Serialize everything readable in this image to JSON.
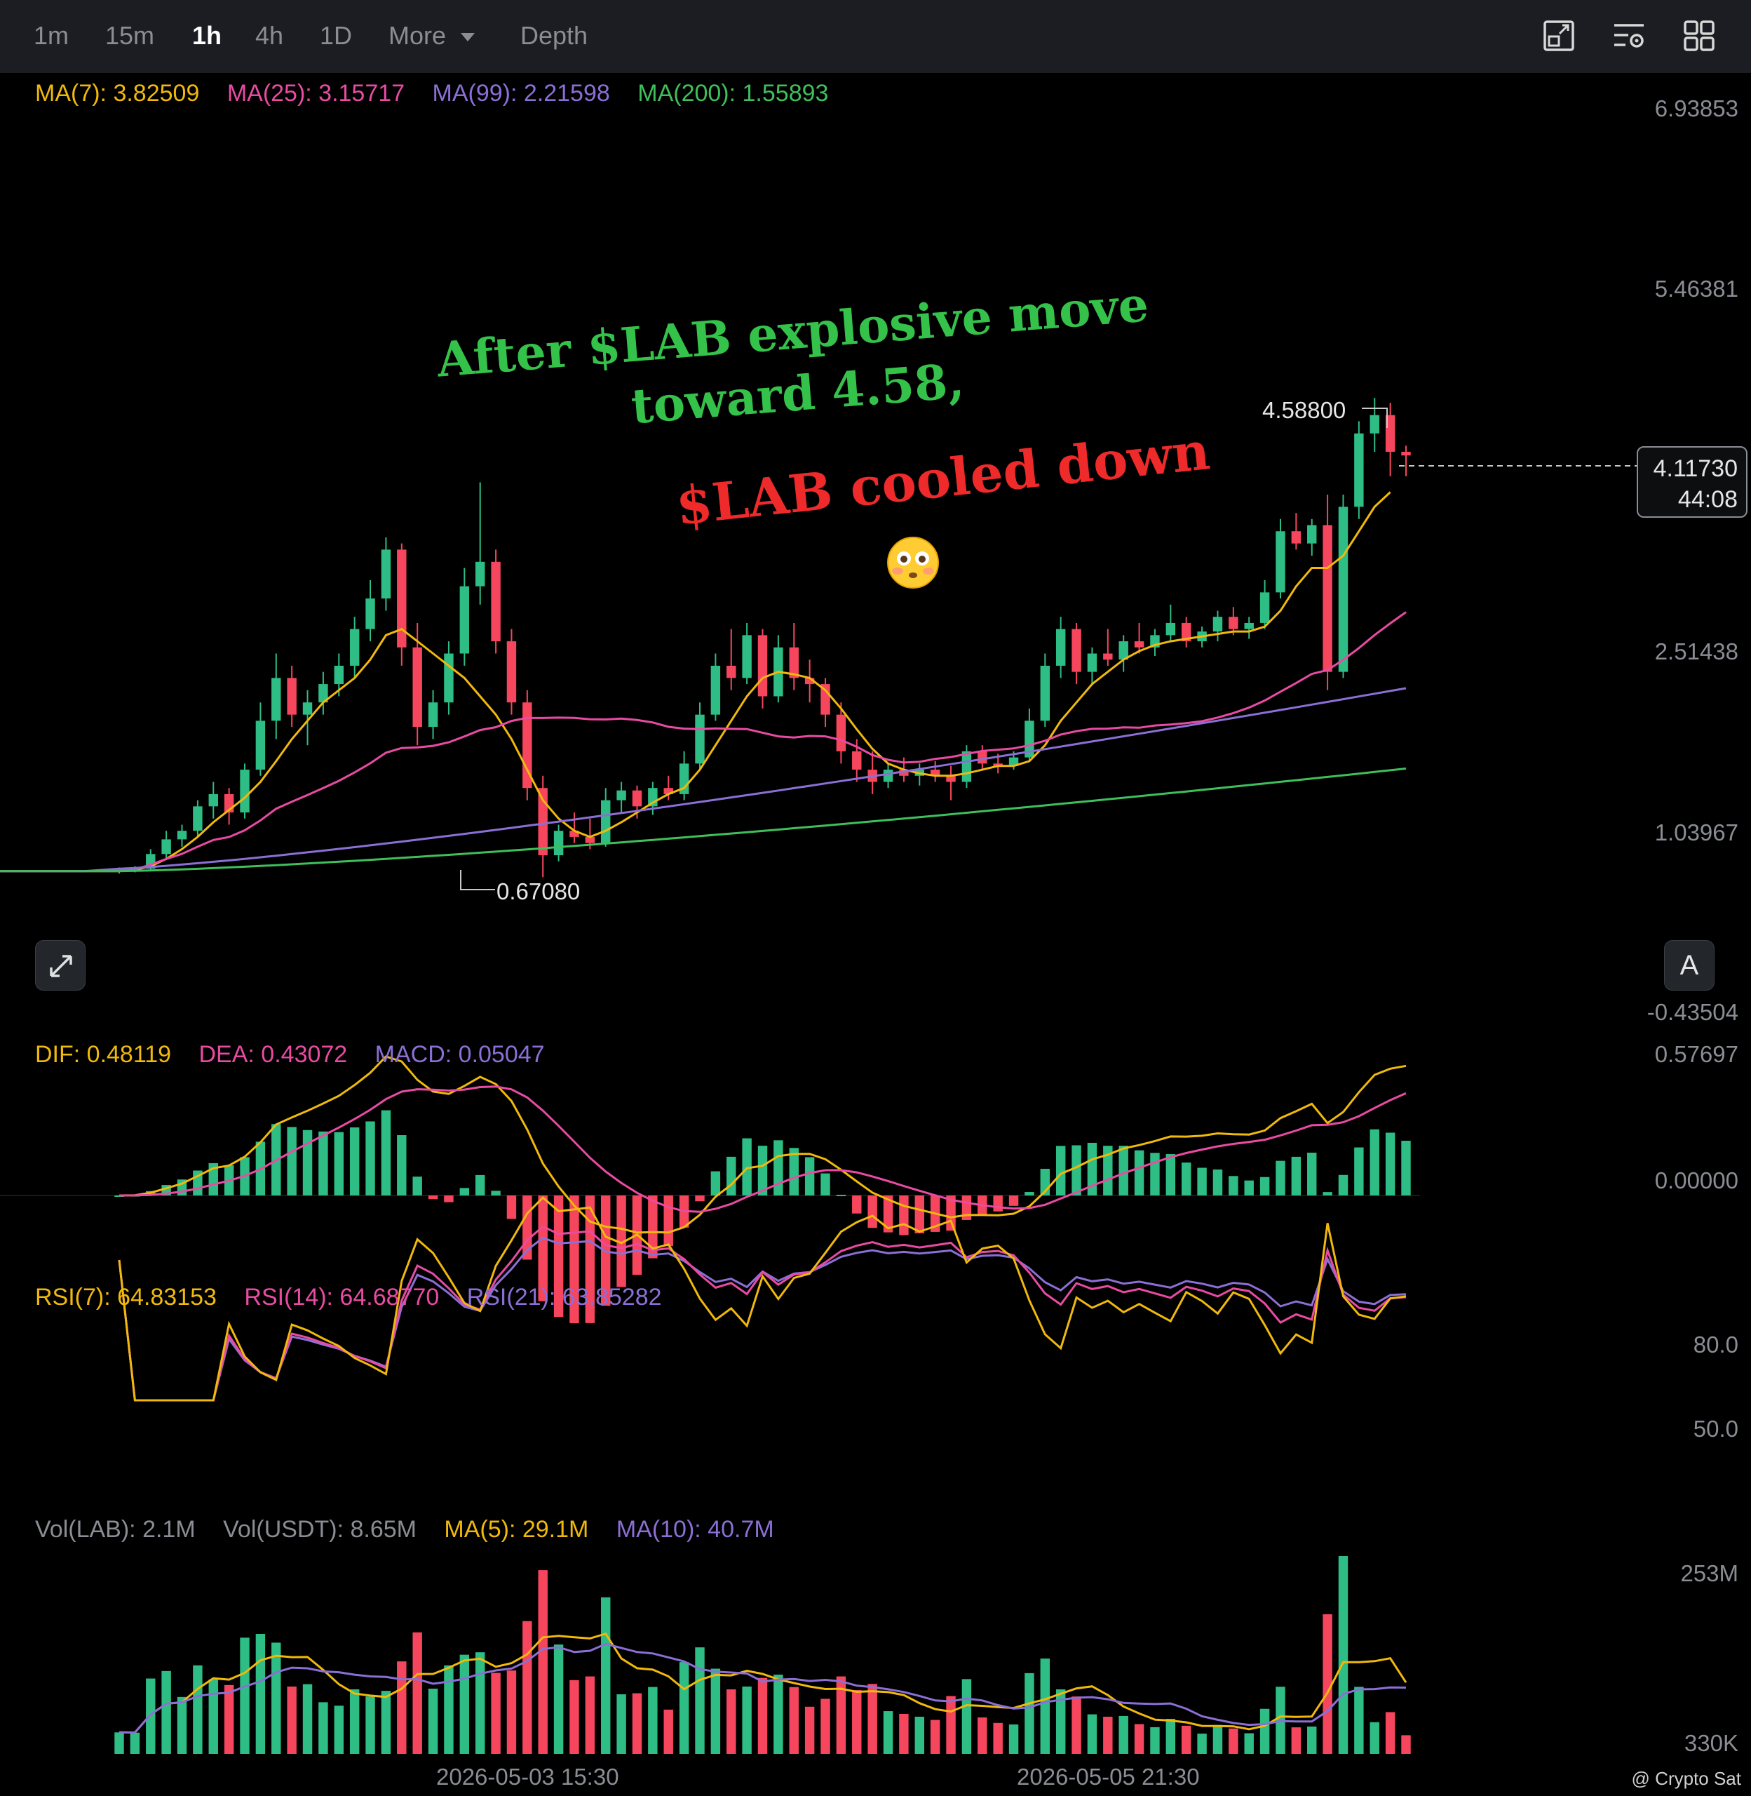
{
  "toolbar": {
    "timeframes": [
      "1m",
      "15m",
      "1h",
      "4h",
      "1D"
    ],
    "active_timeframe": "1h",
    "more_label": "More",
    "depth_label": "Depth",
    "icons": [
      "layout-toggle-icon",
      "indicator-settings-icon",
      "grid-view-icon"
    ]
  },
  "legends": {
    "ma": [
      {
        "text": "MA(7): 3.82509",
        "color": "#f0b90b"
      },
      {
        "text": "MA(25): 3.15717",
        "color": "#e94ba3"
      },
      {
        "text": "MA(99): 2.21598",
        "color": "#8b6fd6"
      },
      {
        "text": "MA(200): 1.55893",
        "color": "#3fbf5c"
      }
    ],
    "macd": [
      {
        "text": "DIF: 0.48119",
        "color": "#f0b90b"
      },
      {
        "text": "DEA: 0.43072",
        "color": "#e94ba3"
      },
      {
        "text": "MACD: 0.05047",
        "color": "#8b6fd6"
      }
    ],
    "rsi": [
      {
        "text": "RSI(7): 64.83153",
        "color": "#f0b90b"
      },
      {
        "text": "RSI(14): 64.68770",
        "color": "#e94ba3"
      },
      {
        "text": "RSI(21): 63.85282",
        "color": "#8b6fd6"
      }
    ],
    "vol": [
      {
        "text": "Vol(LAB): 2.1M",
        "color": "#8a8d93"
      },
      {
        "text": "Vol(USDT): 8.65M",
        "color": "#8a8d93"
      },
      {
        "text": "MA(5): 29.1M",
        "color": "#f0b90b"
      },
      {
        "text": "MA(10): 40.7M",
        "color": "#8b6fd6"
      }
    ]
  },
  "axes": {
    "price_ticks": [
      "6.93853",
      "5.46381",
      "2.51438",
      "1.03967",
      "-0.43504"
    ],
    "macd_ticks": [
      "0.57697",
      "0.00000"
    ],
    "rsi_ticks": [
      "80.0",
      "50.0"
    ],
    "vol_ticks": [
      "253M",
      "330K"
    ],
    "dates": [
      "2026-05-03 15:30",
      "2026-05-05 21:30"
    ]
  },
  "current_price": {
    "price": "4.11730",
    "countdown": "44:08"
  },
  "high_label": "4.58800",
  "low_label": "0.67080",
  "annotations": {
    "line1": "After $LAB explosive move",
    "line2": "toward 4.58,",
    "line3": "$LAB cooled down"
  },
  "auto_button": "A",
  "watermark": "@ Crypto Sat",
  "colors": {
    "up": "#2ebd85",
    "down": "#f6465d",
    "ma7": "#f0b90b",
    "ma25": "#e94ba3",
    "ma99": "#8b6fd6",
    "ma200": "#3fbf5c"
  },
  "chart_data": {
    "type": "candlestick",
    "interval": "1h",
    "ohlc_approx": [
      {
        "o": 0.72,
        "h": 0.75,
        "l": 0.7,
        "c": 0.73
      },
      {
        "o": 0.73,
        "h": 0.76,
        "l": 0.71,
        "c": 0.74
      },
      {
        "o": 0.74,
        "h": 0.9,
        "l": 0.72,
        "c": 0.86
      },
      {
        "o": 0.86,
        "h": 1.05,
        "l": 0.82,
        "c": 0.98
      },
      {
        "o": 0.98,
        "h": 1.1,
        "l": 0.92,
        "c": 1.05
      },
      {
        "o": 1.05,
        "h": 1.3,
        "l": 1.0,
        "c": 1.25
      },
      {
        "o": 1.25,
        "h": 1.45,
        "l": 1.15,
        "c": 1.35
      },
      {
        "o": 1.35,
        "h": 1.4,
        "l": 1.1,
        "c": 1.2
      },
      {
        "o": 1.2,
        "h": 1.6,
        "l": 1.15,
        "c": 1.55
      },
      {
        "o": 1.55,
        "h": 2.1,
        "l": 1.5,
        "c": 1.95
      },
      {
        "o": 1.95,
        "h": 2.5,
        "l": 1.8,
        "c": 2.3
      },
      {
        "o": 2.3,
        "h": 2.4,
        "l": 1.9,
        "c": 2.0
      },
      {
        "o": 2.0,
        "h": 2.2,
        "l": 1.75,
        "c": 2.1
      },
      {
        "o": 2.1,
        "h": 2.35,
        "l": 2.0,
        "c": 2.25
      },
      {
        "o": 2.25,
        "h": 2.5,
        "l": 2.15,
        "c": 2.4
      },
      {
        "o": 2.4,
        "h": 2.8,
        "l": 2.3,
        "c": 2.7
      },
      {
        "o": 2.7,
        "h": 3.1,
        "l": 2.6,
        "c": 2.95
      },
      {
        "o": 2.95,
        "h": 3.45,
        "l": 2.85,
        "c": 3.35
      },
      {
        "o": 3.35,
        "h": 3.4,
        "l": 2.4,
        "c": 2.55
      },
      {
        "o": 2.55,
        "h": 2.75,
        "l": 1.75,
        "c": 1.9
      },
      {
        "o": 1.9,
        "h": 2.2,
        "l": 1.8,
        "c": 2.1
      },
      {
        "o": 2.1,
        "h": 2.6,
        "l": 2.0,
        "c": 2.5
      },
      {
        "o": 2.5,
        "h": 3.2,
        "l": 2.4,
        "c": 3.05
      },
      {
        "o": 3.05,
        "h": 3.9,
        "l": 2.9,
        "c": 3.25
      },
      {
        "o": 3.25,
        "h": 3.35,
        "l": 2.5,
        "c": 2.6
      },
      {
        "o": 2.6,
        "h": 2.7,
        "l": 2.0,
        "c": 2.1
      },
      {
        "o": 2.1,
        "h": 2.2,
        "l": 1.3,
        "c": 1.4
      },
      {
        "o": 1.4,
        "h": 1.5,
        "l": 0.67,
        "c": 0.85
      },
      {
        "o": 0.85,
        "h": 1.1,
        "l": 0.8,
        "c": 1.05
      },
      {
        "o": 1.05,
        "h": 1.2,
        "l": 0.95,
        "c": 1.0
      },
      {
        "o": 1.0,
        "h": 1.15,
        "l": 0.9,
        "c": 0.95
      },
      {
        "o": 0.95,
        "h": 1.4,
        "l": 0.92,
        "c": 1.3
      },
      {
        "o": 1.3,
        "h": 1.45,
        "l": 1.2,
        "c": 1.38
      },
      {
        "o": 1.38,
        "h": 1.42,
        "l": 1.15,
        "c": 1.25
      },
      {
        "o": 1.25,
        "h": 1.45,
        "l": 1.18,
        "c": 1.4
      },
      {
        "o": 1.4,
        "h": 1.5,
        "l": 1.3,
        "c": 1.35
      },
      {
        "o": 1.35,
        "h": 1.7,
        "l": 1.3,
        "c": 1.6
      },
      {
        "o": 1.6,
        "h": 2.1,
        "l": 1.55,
        "c": 2.0
      },
      {
        "o": 2.0,
        "h": 2.5,
        "l": 1.95,
        "c": 2.4
      },
      {
        "o": 2.4,
        "h": 2.7,
        "l": 2.2,
        "c": 2.3
      },
      {
        "o": 2.3,
        "h": 2.75,
        "l": 2.25,
        "c": 2.65
      },
      {
        "o": 2.65,
        "h": 2.7,
        "l": 2.05,
        "c": 2.15
      },
      {
        "o": 2.15,
        "h": 2.65,
        "l": 2.1,
        "c": 2.55
      },
      {
        "o": 2.55,
        "h": 2.75,
        "l": 2.2,
        "c": 2.3
      },
      {
        "o": 2.3,
        "h": 2.45,
        "l": 2.1,
        "c": 2.25
      },
      {
        "o": 2.25,
        "h": 2.3,
        "l": 1.9,
        "c": 2.0
      },
      {
        "o": 2.0,
        "h": 2.1,
        "l": 1.6,
        "c": 1.7
      },
      {
        "o": 1.7,
        "h": 1.8,
        "l": 1.45,
        "c": 1.55
      },
      {
        "o": 1.55,
        "h": 1.7,
        "l": 1.35,
        "c": 1.45
      },
      {
        "o": 1.45,
        "h": 1.6,
        "l": 1.4,
        "c": 1.55
      },
      {
        "o": 1.55,
        "h": 1.65,
        "l": 1.45,
        "c": 1.5
      },
      {
        "o": 1.5,
        "h": 1.6,
        "l": 1.42,
        "c": 1.55
      },
      {
        "o": 1.55,
        "h": 1.62,
        "l": 1.45,
        "c": 1.5
      },
      {
        "o": 1.5,
        "h": 1.58,
        "l": 1.3,
        "c": 1.45
      },
      {
        "o": 1.45,
        "h": 1.75,
        "l": 1.4,
        "c": 1.7
      },
      {
        "o": 1.7,
        "h": 1.75,
        "l": 1.55,
        "c": 1.6
      },
      {
        "o": 1.6,
        "h": 1.68,
        "l": 1.52,
        "c": 1.58
      },
      {
        "o": 1.58,
        "h": 1.7,
        "l": 1.55,
        "c": 1.65
      },
      {
        "o": 1.65,
        "h": 2.05,
        "l": 1.62,
        "c": 1.95
      },
      {
        "o": 1.95,
        "h": 2.5,
        "l": 1.9,
        "c": 2.4
      },
      {
        "o": 2.4,
        "h": 2.8,
        "l": 2.3,
        "c": 2.7
      },
      {
        "o": 2.7,
        "h": 2.75,
        "l": 2.25,
        "c": 2.35
      },
      {
        "o": 2.35,
        "h": 2.55,
        "l": 2.25,
        "c": 2.5
      },
      {
        "o": 2.5,
        "h": 2.7,
        "l": 2.4,
        "c": 2.45
      },
      {
        "o": 2.45,
        "h": 2.65,
        "l": 2.35,
        "c": 2.6
      },
      {
        "o": 2.6,
        "h": 2.75,
        "l": 2.5,
        "c": 2.55
      },
      {
        "o": 2.55,
        "h": 2.7,
        "l": 2.48,
        "c": 2.65
      },
      {
        "o": 2.65,
        "h": 2.9,
        "l": 2.6,
        "c": 2.75
      },
      {
        "o": 2.75,
        "h": 2.8,
        "l": 2.55,
        "c": 2.6
      },
      {
        "o": 2.6,
        "h": 2.72,
        "l": 2.55,
        "c": 2.68
      },
      {
        "o": 2.68,
        "h": 2.85,
        "l": 2.6,
        "c": 2.8
      },
      {
        "o": 2.8,
        "h": 2.88,
        "l": 2.65,
        "c": 2.7
      },
      {
        "o": 2.7,
        "h": 2.8,
        "l": 2.62,
        "c": 2.75
      },
      {
        "o": 2.75,
        "h": 3.1,
        "l": 2.7,
        "c": 3.0
      },
      {
        "o": 3.0,
        "h": 3.6,
        "l": 2.95,
        "c": 3.5
      },
      {
        "o": 3.5,
        "h": 3.65,
        "l": 3.35,
        "c": 3.4
      },
      {
        "o": 3.4,
        "h": 3.6,
        "l": 3.3,
        "c": 3.55
      },
      {
        "o": 3.55,
        "h": 3.8,
        "l": 2.2,
        "c": 2.35
      },
      {
        "o": 2.35,
        "h": 3.8,
        "l": 2.3,
        "c": 3.7
      },
      {
        "o": 3.7,
        "h": 4.4,
        "l": 3.6,
        "c": 4.3
      },
      {
        "o": 4.3,
        "h": 4.59,
        "l": 4.15,
        "c": 4.45
      },
      {
        "o": 4.45,
        "h": 4.55,
        "l": 3.95,
        "c": 4.15
      },
      {
        "o": 4.15,
        "h": 4.2,
        "l": 3.95,
        "c": 4.12
      }
    ],
    "ma7_approx": [
      0.72,
      0.73,
      0.76,
      0.82,
      0.9,
      1.0,
      1.12,
      1.22,
      1.32,
      1.45,
      1.62,
      1.8,
      1.95,
      2.1,
      2.2,
      2.3,
      2.45,
      2.65,
      2.7,
      2.6,
      2.5,
      2.4,
      2.3,
      2.15,
      2.0,
      1.8,
      1.55,
      1.3,
      1.15,
      1.05,
      1.0,
      1.05,
      1.12,
      1.2,
      1.28,
      1.35,
      1.4,
      1.55,
      1.75,
      1.95,
      2.15,
      2.3,
      2.35,
      2.33,
      2.3,
      2.2,
      2.05,
      1.88,
      1.72,
      1.6,
      1.55,
      1.52,
      1.5,
      1.5,
      1.52,
      1.55,
      1.58,
      1.58,
      1.62,
      1.75,
      1.95,
      2.1,
      2.25,
      2.35,
      2.45,
      2.52,
      2.57,
      2.6,
      2.62,
      2.64,
      2.66,
      2.68,
      2.68,
      2.72,
      2.85,
      3.05,
      3.2,
      3.2,
      3.3,
      3.5,
      3.7,
      3.82
    ]
  }
}
